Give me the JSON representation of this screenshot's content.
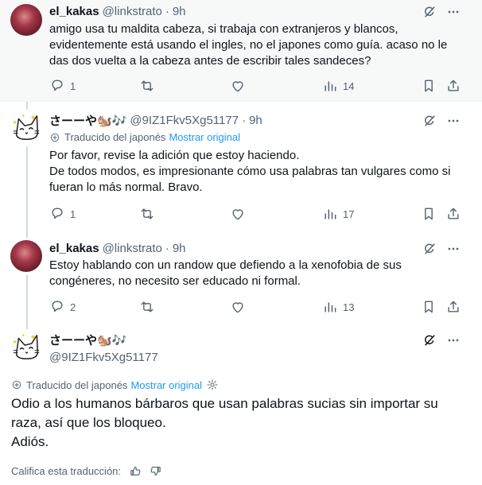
{
  "tweets": [
    {
      "name": "el_kakas",
      "handle": "@linkstrato",
      "time": "9h",
      "body": "amigo usa tu maldita cabeza, si trabaja con extranjeros y blancos, evidentemente está usando el ingles, no el japones como guía. acaso no le das dos vuelta a la cabeza antes de escribir tales sandeces?",
      "replies": "1",
      "views": "14"
    },
    {
      "name": "さーーや🐿️🎶",
      "handle": "@9IZ1Fkv5Xg51177",
      "time": "9h",
      "translated_label": "Traducido del japonés",
      "show_original": "Mostrar original",
      "body": "Por favor, revise la adición que estoy haciendo.\nDe todos modos, es impresionante cómo usa palabras tan vulgares como si fueran lo más normal. Bravo.",
      "replies": "1",
      "views": "17"
    },
    {
      "name": "el_kakas",
      "handle": "@linkstrato",
      "time": "9h",
      "body": "Estoy hablando con un randow que defiendo a la xenofobia de sus congéneres, no necesito ser educado ni formal.",
      "replies": "2",
      "views": "13"
    },
    {
      "name": "さーーや🐿️🎶",
      "handle": "@9IZ1Fkv5Xg51177",
      "translated_label": "Traducido del japonés",
      "show_original": "Mostrar original",
      "body": "Odio a los humanos bárbaros que usan palabras sucias sin importar su raza, así que los bloqueo.\nAdiós.",
      "rate_label": "Califica esta traducción:"
    }
  ],
  "icons": [
    "grok-icon",
    "more-icon",
    "reply-icon",
    "retweet-icon",
    "like-icon",
    "views-icon",
    "bookmark-icon",
    "share-icon",
    "translate-icon",
    "settings-icon",
    "thumbs-up-icon",
    "thumbs-down-icon"
  ],
  "colors": {
    "link": "#1d9bf0",
    "muted": "#536471",
    "text": "#0f1419",
    "highlight": "#f7f9f9"
  }
}
